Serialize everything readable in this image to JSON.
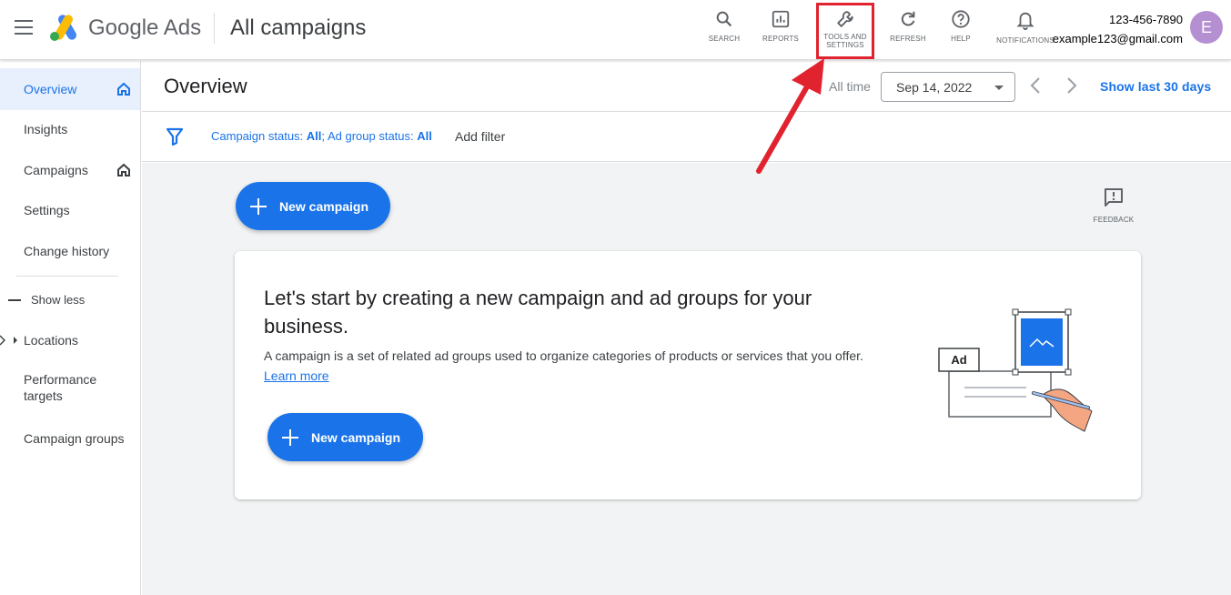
{
  "header": {
    "brand": "Google Ads",
    "page_title": "All campaigns",
    "tools": [
      {
        "id": "search",
        "label": "SEARCH"
      },
      {
        "id": "reports",
        "label": "REPORTS"
      },
      {
        "id": "tools",
        "label": "TOOLS AND SETTINGS"
      },
      {
        "id": "refresh",
        "label": "REFRESH"
      },
      {
        "id": "help",
        "label": "HELP"
      },
      {
        "id": "notifications",
        "label": "NOTIFICATIONS"
      }
    ],
    "account": {
      "phone": "123-456-7890",
      "email": "example123@gmail.com",
      "avatar_letter": "E"
    }
  },
  "sidebar": {
    "items": [
      {
        "label": "Overview"
      },
      {
        "label": "Insights"
      },
      {
        "label": "Campaigns"
      },
      {
        "label": "Settings"
      },
      {
        "label": "Change history"
      },
      {
        "label": "Show less"
      },
      {
        "label": "Locations"
      },
      {
        "label": "Performance targets"
      },
      {
        "label": "Campaign groups"
      }
    ]
  },
  "subheader": {
    "title": "Overview",
    "range_label": "All time",
    "date": "Sep 14, 2022",
    "show_last": "Show last 30 days"
  },
  "filter": {
    "campaign_status_label": "Campaign status:",
    "campaign_status_value": "All",
    "sep": ";",
    "ad_group_status_label": "Ad group status:",
    "ad_group_status_value": "All",
    "add_filter": "Add filter"
  },
  "main": {
    "new_campaign_label": "New campaign",
    "feedback_label": "FEEDBACK",
    "card": {
      "title": "Let's start by creating a new campaign and ad groups for your business.",
      "description": "A campaign is a set of related ad groups used to organize categories of products or services that you offer.",
      "learn_more": "Learn more",
      "button_label": "New campaign",
      "illustration_ad": "Ad"
    }
  },
  "colors": {
    "primary": "#1a73e8",
    "highlight": "#e1232f",
    "avatar": "#b48fd2"
  }
}
